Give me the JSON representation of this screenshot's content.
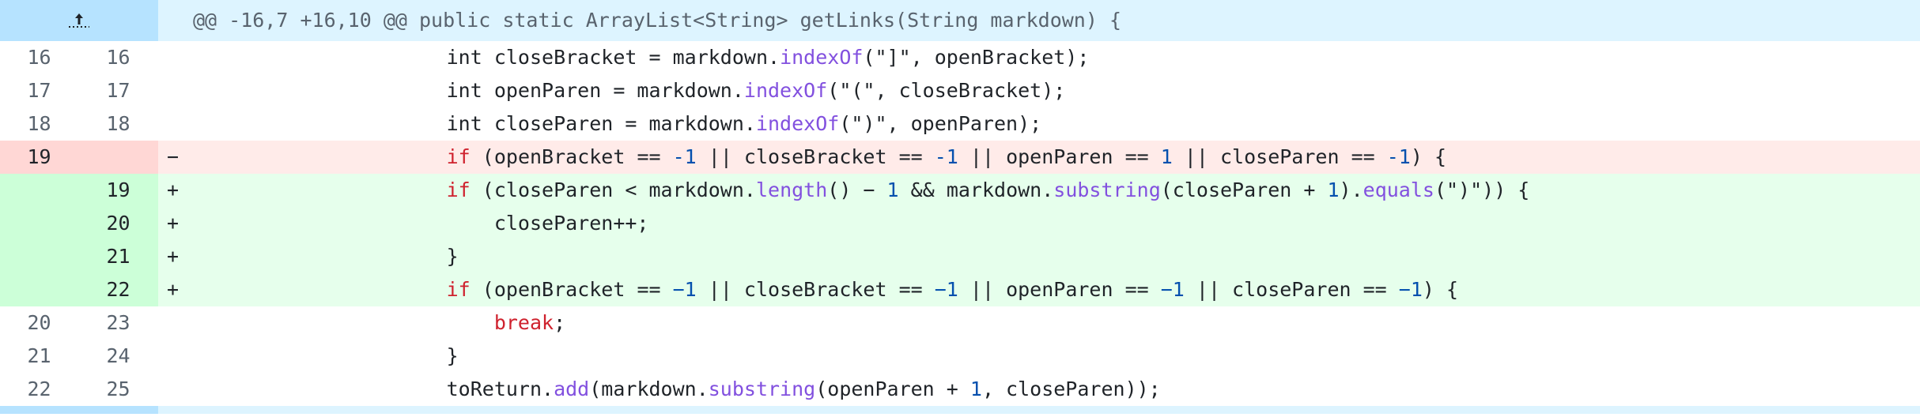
{
  "colors": {
    "hunk_bg": "#ddf4ff",
    "expander_bg": "#b6e3ff",
    "deletion_bg": "#ffebe9",
    "deletion_gutter_bg": "#ffd7d5",
    "addition_bg": "#e6ffec",
    "addition_gutter_bg": "#ccffd8",
    "keyword": "#cf222e",
    "method": "#8250df",
    "number": "#0550ae"
  },
  "hunk": {
    "expand_icon": "expand-up-icon",
    "header": "@@ -16,7 +16,10 @@ public static ArrayList<String> getLinks(String markdown) {"
  },
  "lines": [
    {
      "type": "context",
      "old": "16",
      "new": "16",
      "sign": "",
      "tokens": [
        [
          "",
          "            int closeBracket = markdown."
        ],
        [
          "fn",
          "indexOf"
        ],
        [
          "",
          "(\"]\", openBracket);"
        ]
      ]
    },
    {
      "type": "context",
      "old": "17",
      "new": "17",
      "sign": "",
      "tokens": [
        [
          "",
          "            int openParen = markdown."
        ],
        [
          "fn",
          "indexOf"
        ],
        [
          "",
          "(\"(\", closeBracket);"
        ]
      ]
    },
    {
      "type": "context",
      "old": "18",
      "new": "18",
      "sign": "",
      "tokens": [
        [
          "",
          "            int closeParen = markdown."
        ],
        [
          "fn",
          "indexOf"
        ],
        [
          "",
          "(\")\", openParen);"
        ]
      ]
    },
    {
      "type": "del",
      "old": "19",
      "new": "",
      "sign": "−",
      "tokens": [
        [
          "",
          "            "
        ],
        [
          "kw",
          "if"
        ],
        [
          "",
          " (openBracket == "
        ],
        [
          "num",
          "-1"
        ],
        [
          "",
          " || closeBracket == "
        ],
        [
          "num",
          "-1"
        ],
        [
          "",
          " || openParen == "
        ],
        [
          "num",
          "1"
        ],
        [
          "",
          " || closeParen == "
        ],
        [
          "num",
          "-1"
        ],
        [
          "",
          ") {"
        ]
      ]
    },
    {
      "type": "add",
      "old": "",
      "new": "19",
      "sign": "+",
      "tokens": [
        [
          "",
          "            "
        ],
        [
          "kw",
          "if"
        ],
        [
          "",
          " (closeParen < markdown."
        ],
        [
          "fn",
          "length"
        ],
        [
          "",
          "() − "
        ],
        [
          "num",
          "1"
        ],
        [
          "",
          " && markdown."
        ],
        [
          "fn",
          "substring"
        ],
        [
          "",
          "(closeParen + "
        ],
        [
          "num",
          "1"
        ],
        [
          "",
          ")."
        ],
        [
          "fn",
          "equals"
        ],
        [
          "",
          "(\")\")) {"
        ]
      ]
    },
    {
      "type": "add",
      "old": "",
      "new": "20",
      "sign": "+",
      "tokens": [
        [
          "",
          "                closeParen++;"
        ]
      ]
    },
    {
      "type": "add",
      "old": "",
      "new": "21",
      "sign": "+",
      "tokens": [
        [
          "",
          "            }"
        ]
      ]
    },
    {
      "type": "add",
      "old": "",
      "new": "22",
      "sign": "+",
      "tokens": [
        [
          "",
          "            "
        ],
        [
          "kw",
          "if"
        ],
        [
          "",
          " (openBracket == "
        ],
        [
          "num",
          "−1"
        ],
        [
          "",
          " || closeBracket == "
        ],
        [
          "num",
          "−1"
        ],
        [
          "",
          " || openParen == "
        ],
        [
          "num",
          "−1"
        ],
        [
          "",
          " || closeParen == "
        ],
        [
          "num",
          "−1"
        ],
        [
          "",
          ") {"
        ]
      ]
    },
    {
      "type": "context",
      "old": "20",
      "new": "23",
      "sign": "",
      "tokens": [
        [
          "",
          "                "
        ],
        [
          "kw",
          "break"
        ],
        [
          "",
          ";"
        ]
      ]
    },
    {
      "type": "context",
      "old": "21",
      "new": "24",
      "sign": "",
      "tokens": [
        [
          "",
          "            }"
        ]
      ]
    },
    {
      "type": "context",
      "old": "22",
      "new": "25",
      "sign": "",
      "tokens": [
        [
          "",
          "            toReturn."
        ],
        [
          "fn",
          "add"
        ],
        [
          "",
          "(markdown."
        ],
        [
          "fn",
          "substring"
        ],
        [
          "",
          "(openParen + "
        ],
        [
          "num",
          "1"
        ],
        [
          "",
          ", closeParen));"
        ]
      ]
    }
  ]
}
